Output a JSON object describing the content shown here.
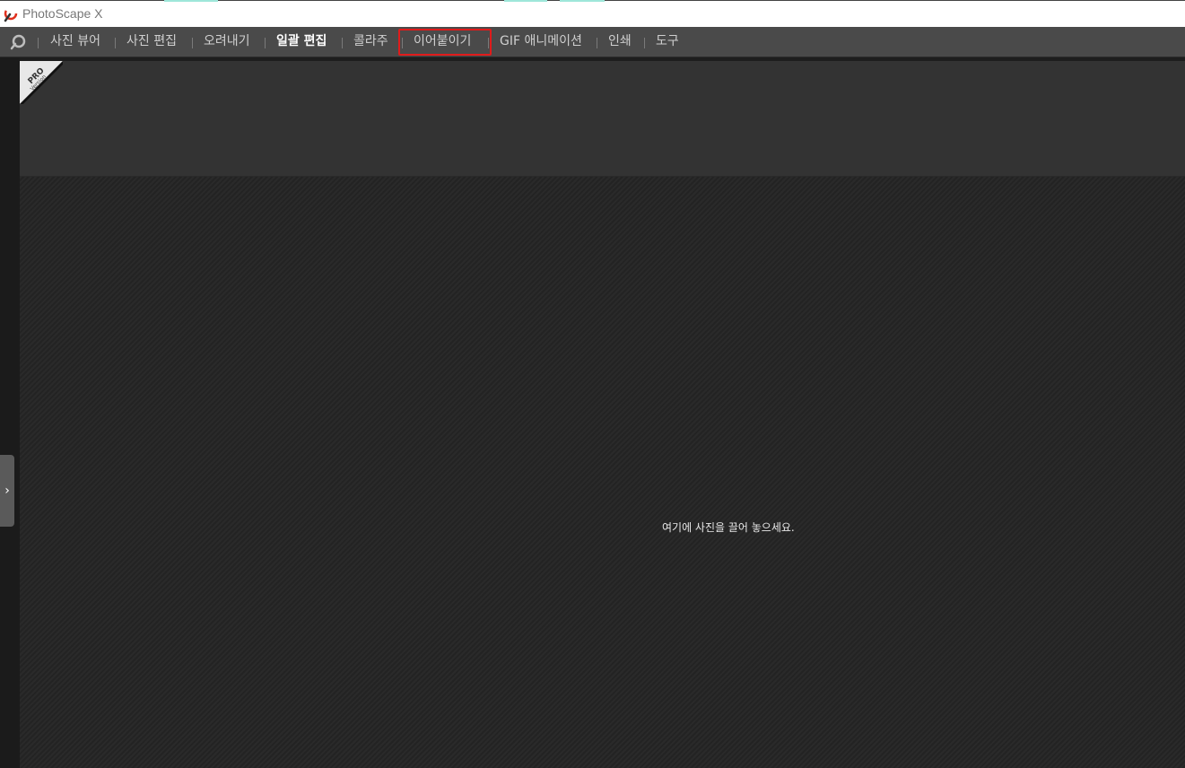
{
  "window": {
    "title": "PhotoScape X"
  },
  "menu": {
    "items": [
      {
        "label": "사진 뷰어"
      },
      {
        "label": "사진 편집"
      },
      {
        "label": "오려내기"
      },
      {
        "label": "일괄 편집"
      },
      {
        "label": "콜라주"
      },
      {
        "label": "이어붙이기"
      },
      {
        "label": "GIF 애니메이션"
      },
      {
        "label": "인쇄"
      },
      {
        "label": "도구"
      }
    ]
  },
  "badge": {
    "line1": "PRO",
    "line2": "Version"
  },
  "drop_area": {
    "message": "여기에 사진을 끌어 놓으세요."
  },
  "colors": {
    "highlight": "#e01b1b",
    "menubar": "#4a4a4a",
    "logo_red": "#e0301e"
  }
}
